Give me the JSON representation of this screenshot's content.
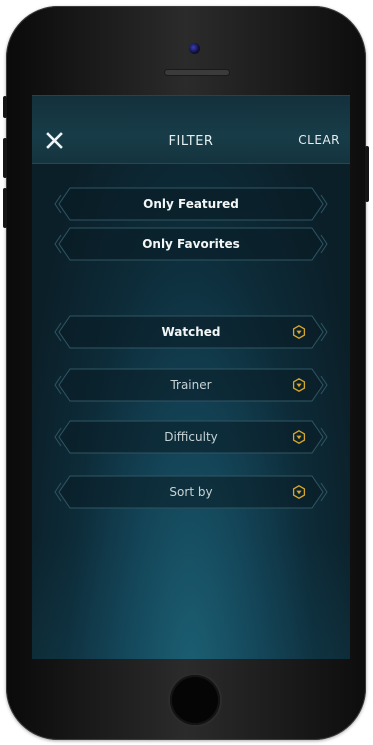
{
  "header": {
    "title": "FILTER",
    "clear_label": "CLEAR",
    "close_icon": "close-icon"
  },
  "toggles": [
    {
      "label": "Only Featured"
    },
    {
      "label": "Only Favorites"
    }
  ],
  "dropdowns": [
    {
      "label": "Watched",
      "icon": "chevron-down-icon"
    },
    {
      "label": "Trainer",
      "icon": "chevron-down-icon"
    },
    {
      "label": "Difficulty",
      "icon": "chevron-down-icon"
    },
    {
      "label": "Sort by",
      "icon": "chevron-down-icon"
    }
  ],
  "colors": {
    "accent": "#d8a62b",
    "background": "#0d2b38",
    "header": "#173c48",
    "text": "#e6eef0"
  }
}
